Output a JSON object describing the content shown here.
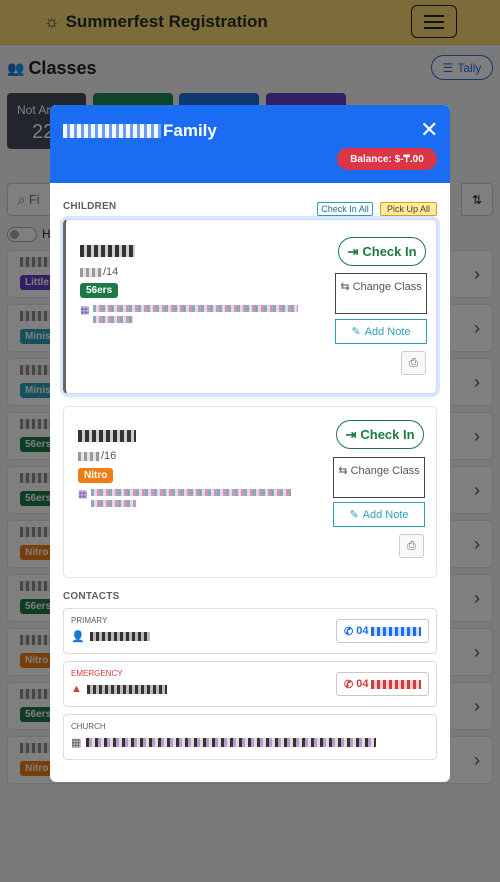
{
  "app": {
    "title": "Summerfest Registration",
    "sun_icon": "sun-icon",
    "menu_icon": "hamburger-icon"
  },
  "page": {
    "title": "Classes",
    "tally_label": "Tally",
    "stats": [
      {
        "label": "Not Ar",
        "value": "22"
      }
    ],
    "search_placeholder": "Fi",
    "toggle_label": "H",
    "rows": [
      {
        "tag": "Little",
        "color": "#6a3fc7"
      },
      {
        "tag": "Minis",
        "color": "#2aa0b8"
      },
      {
        "tag": "Minis",
        "color": "#2aa0b8"
      },
      {
        "tag": "56ers",
        "color": "#1d7a47"
      },
      {
        "tag": "56ers",
        "color": "#1d7a47"
      },
      {
        "tag": "Nitro",
        "color": "#f07d12"
      },
      {
        "tag": "56ers",
        "color": "#1d7a47"
      },
      {
        "tag": "Nitro",
        "color": "#f07d12"
      },
      {
        "tag": "56ers",
        "color": "#1d7a47"
      },
      {
        "tag": "Nitro",
        "color": "#f07d12"
      }
    ]
  },
  "modal": {
    "family_suffix": "Family",
    "balance_label": "Balance: $-₸.00",
    "children_label": "CHILDREN",
    "check_in_all": "Check In All",
    "pick_up_all": "Pick Up All",
    "children": [
      {
        "age": "/14",
        "group": "56ers",
        "group_color": "#1d7a47",
        "check_in": "Check In",
        "change_class": "Change Class",
        "add_note": "Add Note"
      },
      {
        "age": "/16",
        "group": "Nitro",
        "group_color": "#f07d12",
        "check_in": "Check In",
        "change_class": "Change Class",
        "add_note": "Add Note"
      }
    ],
    "contacts_label": "CONTACTS",
    "contacts": [
      {
        "type": "PRIMARY",
        "phone_prefix": "04",
        "phone_color": "#1a6cf2"
      },
      {
        "type": "EMERGENCY",
        "phone_prefix": "04",
        "phone_color": "#d03a3a"
      },
      {
        "type": "CHURCH"
      }
    ]
  }
}
